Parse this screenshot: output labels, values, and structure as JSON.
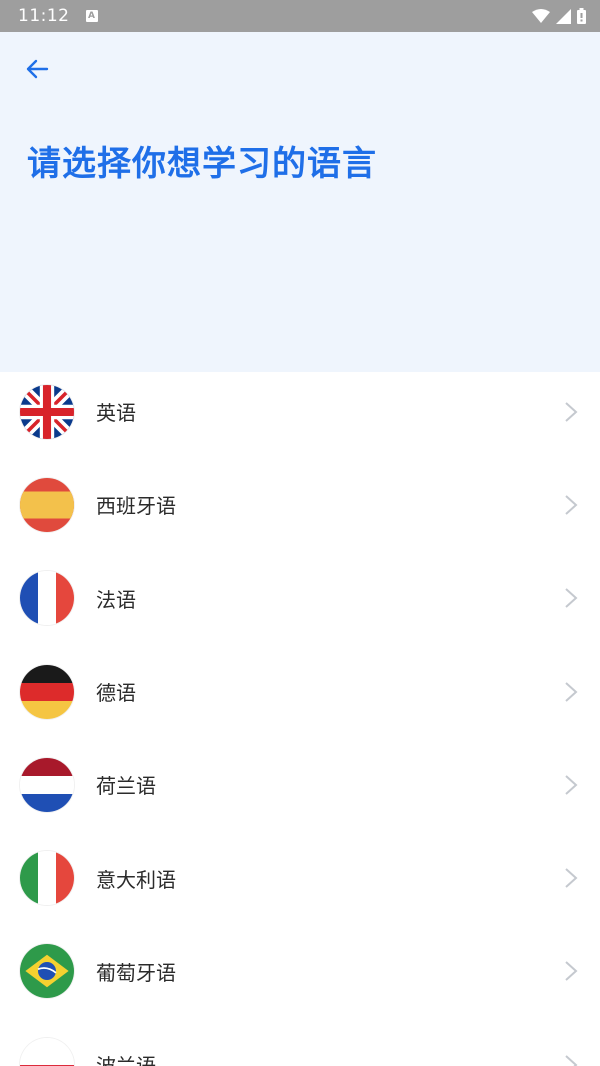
{
  "status_bar": {
    "time": "11:12",
    "notification_icon_letter": "A"
  },
  "header": {
    "back_icon": "arrow-left-icon",
    "title": "请选择你想学习的语言"
  },
  "languages": [
    {
      "name": "英语",
      "flag": "uk-flag-icon"
    },
    {
      "name": "西班牙语",
      "flag": "spain-flag-icon"
    },
    {
      "name": "法语",
      "flag": "france-flag-icon"
    },
    {
      "name": "德语",
      "flag": "germany-flag-icon"
    },
    {
      "name": "荷兰语",
      "flag": "netherlands-flag-icon"
    },
    {
      "name": "意大利语",
      "flag": "italy-flag-icon"
    },
    {
      "name": "葡萄牙语",
      "flag": "brazil-flag-icon"
    },
    {
      "name": "波兰语",
      "flag": "poland-flag-icon"
    }
  ],
  "colors": {
    "accent": "#1f6fe8",
    "header_bg": "#eff5fd",
    "status_bar_bg": "#9e9e9e",
    "chevron": "#c5c9cf"
  }
}
